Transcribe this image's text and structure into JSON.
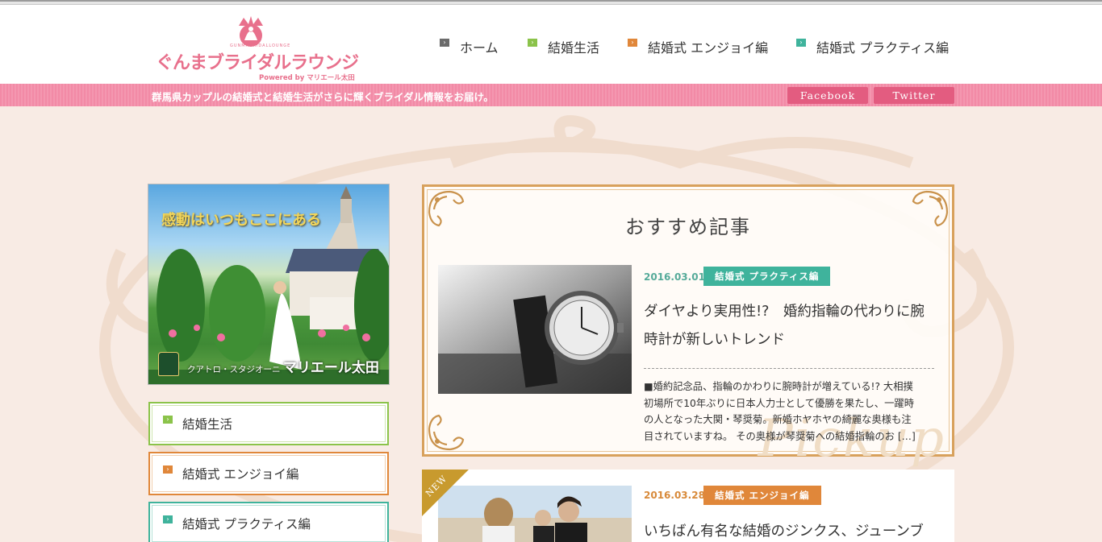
{
  "header": {
    "logo_main": "ぐんまブライダルラウンジ",
    "logo_sub": "Powered by マリエール太田",
    "logo_arc": "GUNMABRIDALLOUNGE"
  },
  "nav": {
    "items": [
      {
        "label": "ホーム",
        "color": "#6b6b6b"
      },
      {
        "label": "結婚生活",
        "color": "#8bc34a"
      },
      {
        "label": "結婚式 エンジョイ編",
        "color": "#e0873a"
      },
      {
        "label": "結婚式 プラクティス編",
        "color": "#3fb39c"
      }
    ]
  },
  "band": {
    "tagline": "群馬県カップルの結婚式と結婚生活がさらに輝くブライダル情報をお届け。",
    "facebook": "Facebook",
    "twitter": "Twitter"
  },
  "sidebar": {
    "ad": {
      "title": "感動はいつもここにある",
      "brand_small": "クアトロ・スタジオーニ",
      "brand_big": "マリエール太田"
    },
    "categories": [
      {
        "label": "結婚生活",
        "color": "#8bc34a"
      },
      {
        "label": "結婚式 エンジョイ編",
        "color": "#e0873a"
      },
      {
        "label": "結婚式 プラクティス編",
        "color": "#3fb39c"
      }
    ]
  },
  "pickup": {
    "heading": "おすすめ記事",
    "watermark": "Pickup",
    "article": {
      "date": "2016.03.01",
      "category": "結婚式 プラクティス編",
      "category_color": "#3fb39c",
      "title_line1": "ダイヤより実用性!?　婚約指輪の代わりに腕",
      "title_line2": "時計が新しいトレンド",
      "excerpt_lines": [
        "■婚約記念品、指輪のかわりに腕時計が増えている!? 大相撲",
        "初場所で10年ぶりに日本人力士として優勝を果たし、一躍時",
        "の人となった大関・琴奨菊。新婚ホヤホヤの綺麗な奥様も注",
        "目されていますね。 その奥様が琴奨菊への結婚指輪のお […]"
      ]
    }
  },
  "second_article": {
    "ribbon": "NEW",
    "date": "2016.03.28",
    "category": "結婚式 エンジョイ編",
    "category_color": "#e0873a",
    "title": "いちばん有名な結婚のジンクス、ジューンブ"
  },
  "colors": {
    "accent_pink": "#f28aa6",
    "social_button": "#e35c80",
    "gold_frame": "#d8a15c"
  }
}
